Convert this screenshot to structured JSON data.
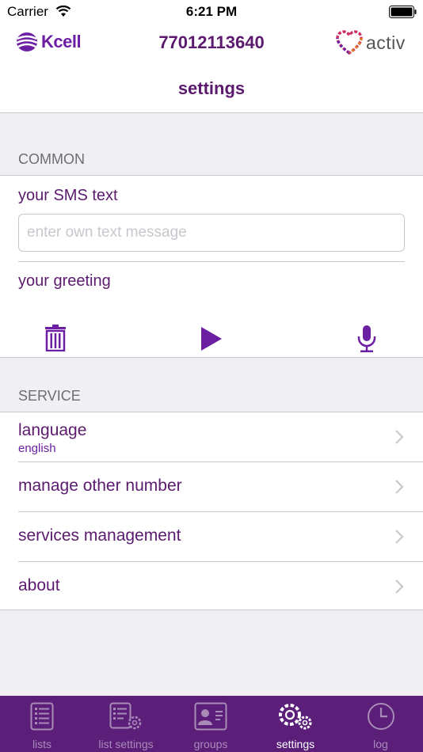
{
  "status_bar": {
    "carrier": "Carrier",
    "time": "6:21 PM"
  },
  "header": {
    "left_logo_text": "Kcell",
    "phone_number": "77012113640",
    "right_logo_text": "activ",
    "title": "settings"
  },
  "common": {
    "section_label": "COMMON",
    "sms_label": "your SMS text",
    "sms_placeholder": "enter own text message",
    "sms_value": "",
    "greeting_label": "your greeting",
    "icons": [
      "trash-icon",
      "play-icon",
      "microphone-icon"
    ]
  },
  "service": {
    "section_label": "SERVICE",
    "items": [
      {
        "label": "language",
        "sublabel": "english"
      },
      {
        "label": "manage other number"
      },
      {
        "label": "services management"
      },
      {
        "label": "about"
      }
    ]
  },
  "tabbar": {
    "tabs": [
      {
        "label": "lists",
        "icon": "list-icon"
      },
      {
        "label": "list settings",
        "icon": "list-settings-icon"
      },
      {
        "label": "groups",
        "icon": "contact-card-icon"
      },
      {
        "label": "settings",
        "icon": "gears-icon",
        "active": true
      },
      {
        "label": "log",
        "icon": "clock-icon"
      }
    ]
  },
  "colors": {
    "brand_purple": "#5b1a6e",
    "accent_violet": "#6c1fa2",
    "tabbar_bg": "#5b1f7a"
  }
}
